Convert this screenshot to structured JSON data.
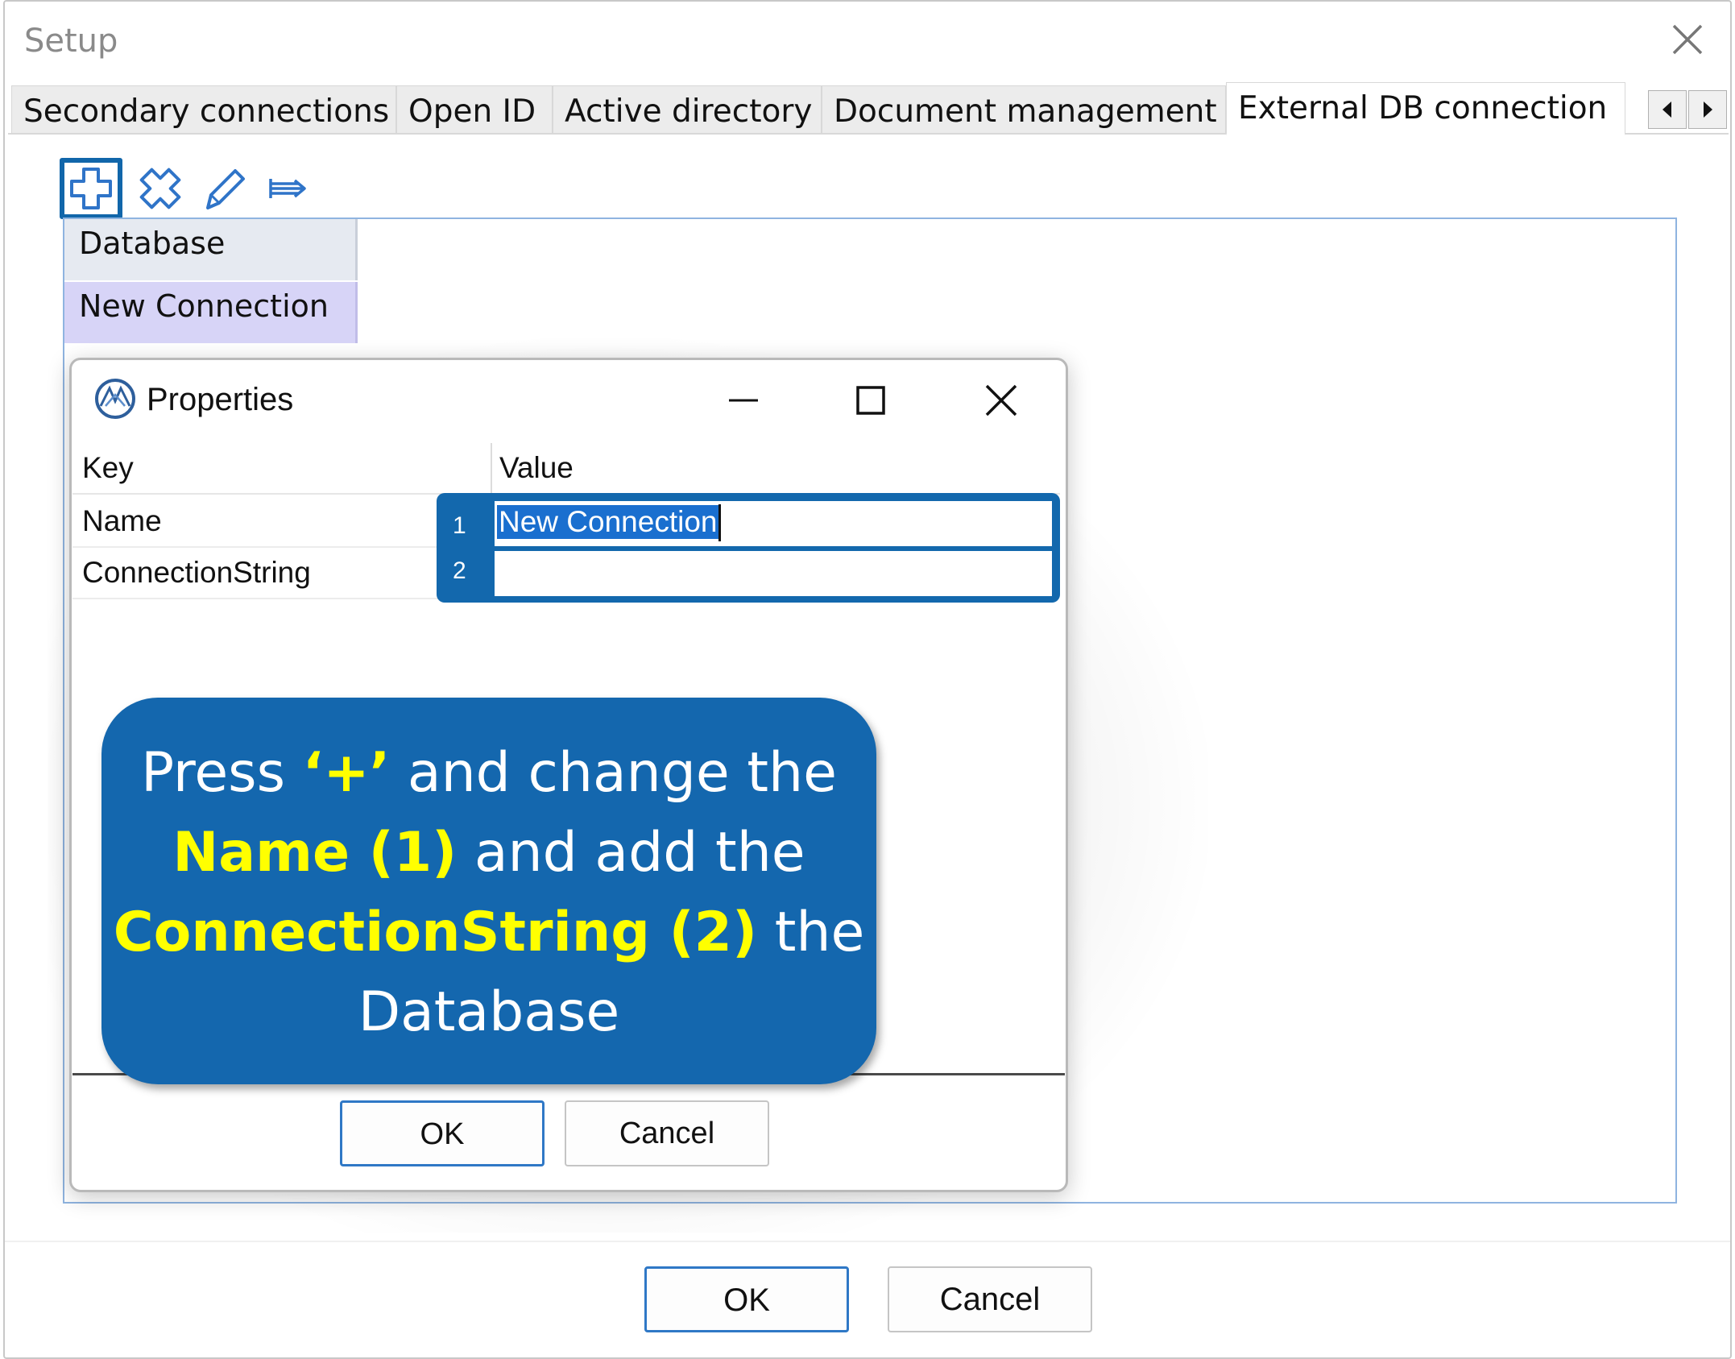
{
  "setup": {
    "title": "Setup",
    "tabs": [
      {
        "label": "Secondary connections"
      },
      {
        "label": "Open ID"
      },
      {
        "label": "Active directory"
      },
      {
        "label": "Document management"
      },
      {
        "label": "External DB connection"
      }
    ],
    "active_tab": "External DB connection",
    "toolbar": [
      "add-icon",
      "delete-icon",
      "edit-icon",
      "export-icon"
    ],
    "list": {
      "header": "Database",
      "rows": [
        {
          "label": "New Connection"
        }
      ]
    },
    "ok_label": "OK",
    "cancel_label": "Cancel"
  },
  "properties": {
    "title": "Properties",
    "columns": {
      "key": "Key",
      "value": "Value"
    },
    "rows": [
      {
        "number": "1",
        "key": "Name",
        "value": "New Connection"
      },
      {
        "number": "2",
        "key": "ConnectionString",
        "value": ""
      }
    ],
    "ok_label": "OK",
    "cancel_label": "Cancel"
  },
  "callout": {
    "part1": "Press ",
    "plus": "‘+’",
    "part2": " and change the ",
    "name": "Name (1)",
    "part3": " and add the ",
    "conn": "ConnectionString (2)",
    "part4": " the Database"
  },
  "colors": {
    "accent_blue": "#1467ae",
    "highlight_yellow": "#ffff00",
    "selection_row": "#d7d4f7"
  }
}
